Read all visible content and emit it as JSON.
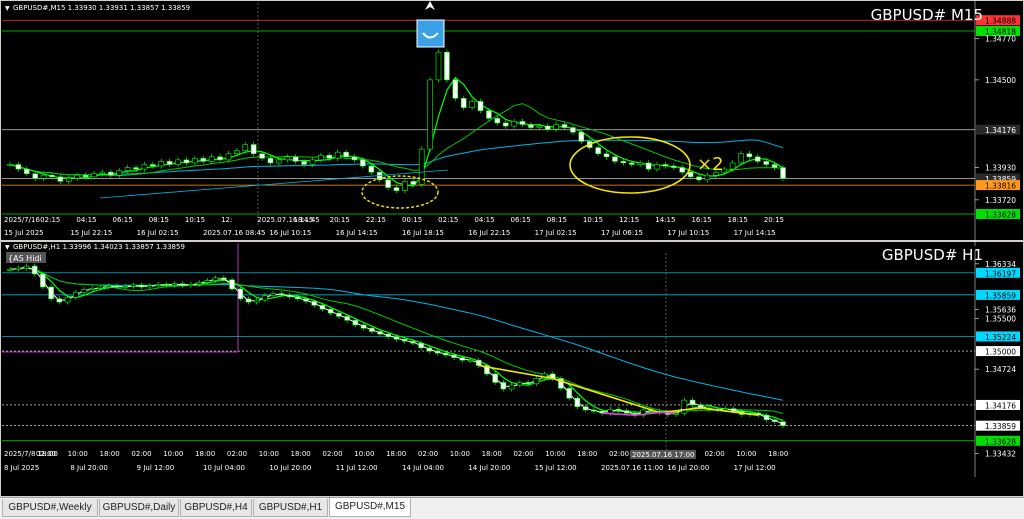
{
  "colors": {
    "background": "#000000",
    "grid_text": "#ffffff",
    "price_line": "#00ff00",
    "ma_fast": "#00c800",
    "ma_slow": "#00b4e6",
    "ma_white": "#ffffff",
    "annotation_yellow": "#f5e600",
    "annotation_magenta": "#e040e0",
    "level_cyan": "#00d8ff",
    "level_green": "#00e000",
    "level_orange": "#ff9a1a",
    "tag_dark": "#2a2a2a"
  },
  "icons": [
    "chevron-down-icon",
    "buy-signal-icon",
    "arrow-down-icon"
  ],
  "chart_data": [
    {
      "type": "line",
      "panel": "top",
      "symbol_header": "GBPUSD#,M15  1.33930 1.33931 1.33857 1.33859",
      "title": "GBPUSD# M15",
      "ylim": [
        1.3355,
        1.35
      ],
      "y_ticks": [
        "1.34888",
        "1.34818",
        "1.34770",
        "1.34500",
        "1.34176",
        "1.33930",
        "1.33859",
        "1.33816",
        "1.33720",
        "1.33628"
      ],
      "highlighted_levels": [
        {
          "label": "1.34888",
          "value": 1.34888,
          "tag_color": "#ff3333"
        },
        {
          "label": "1.34818",
          "value": 1.34818,
          "tag_color": "#00e000"
        },
        {
          "label": "1.34176",
          "value": 1.34176,
          "tag_color": "#2a2a2a"
        },
        {
          "label": "1.33859",
          "value": 1.33859,
          "tag_color": "#2a2a2a"
        },
        {
          "label": "1.33816",
          "value": 1.33816,
          "tag_color": "#ff9a1a"
        },
        {
          "label": "1.33628",
          "value": 1.33628,
          "tag_color": "#00e000"
        }
      ],
      "x_tick_labels_row1": [
        "2025/7/16",
        "02:15",
        "04:15",
        "06:15",
        "08:15",
        "10:15",
        "12:",
        "2025.07.16 14:45",
        "18:15",
        "20:15",
        "22:15",
        "00:15",
        "02:15",
        "04:15",
        "06:15",
        "08:15",
        "10:15",
        "12:15",
        "14:15",
        "16:15",
        "18:15",
        "20:15"
      ],
      "x_tick_labels_row2": [
        "15 Jul 2025",
        "15 Jul 22:15",
        "16 Jul 02:15",
        "2025.07.16 08:45",
        "16 Jul 10:15",
        "16 Jul 14:15",
        "16 Jul 18:15",
        "16 Jul 22:15",
        "17 Jul 02:15",
        "17 Jul 06:15",
        "17 Jul 10:15",
        "17 Jul 14:15"
      ],
      "close": [
        1.3395,
        1.3392,
        1.3389,
        1.3386,
        1.3388,
        1.3387,
        1.3384,
        1.3386,
        1.3388,
        1.3387,
        1.3389,
        1.339,
        1.3388,
        1.3391,
        1.3393,
        1.3392,
        1.3395,
        1.3394,
        1.3397,
        1.3395,
        1.3398,
        1.3396,
        1.3399,
        1.3397,
        1.34,
        1.3398,
        1.3402,
        1.3404,
        1.3408,
        1.3402,
        1.3399,
        1.3396,
        1.3398,
        1.34,
        1.3397,
        1.3395,
        1.3398,
        1.3401,
        1.3399,
        1.3403,
        1.34,
        1.3398,
        1.3394,
        1.339,
        1.3385,
        1.338,
        1.3378,
        1.3384,
        1.3382,
        1.3405,
        1.345,
        1.3468,
        1.345,
        1.3438,
        1.3432,
        1.3436,
        1.343,
        1.3425,
        1.3422,
        1.342,
        1.3423,
        1.3421,
        1.3419,
        1.342,
        1.3418,
        1.3421,
        1.3419,
        1.3416,
        1.341,
        1.3406,
        1.3402,
        1.34,
        1.3397,
        1.3396,
        1.3395,
        1.3396,
        1.3392,
        1.3395,
        1.3394,
        1.3393,
        1.339,
        1.3387,
        1.3385,
        1.3388,
        1.339,
        1.3392,
        1.3396,
        1.3402,
        1.34,
        1.3397,
        1.3395,
        1.3393,
        1.3386
      ]
    },
    {
      "type": "line",
      "panel": "bottom",
      "symbol_header": "GBPUSD#,H1  1.33996 1.34023 1.33857 1.33859",
      "title": "GBPUSD# H1",
      "badge": "{AS Hidi",
      "ylim": [
        1.3338,
        1.365
      ],
      "y_ticks": [
        "1.36334",
        "1.36197",
        "1.35859",
        "1.35636",
        "1.35500",
        "1.35224",
        "1.35000",
        "1.34724",
        "1.34176",
        "1.33859",
        "1.33628",
        "1.33432"
      ],
      "highlighted_levels": [
        {
          "label": "1.36197",
          "value": 1.36197,
          "tag_color": "#00d8ff"
        },
        {
          "label": "1.35859",
          "value": 1.35859,
          "tag_color": "#00d8ff"
        },
        {
          "label": "1.35224",
          "value": 1.35224,
          "tag_color": "#00d8ff"
        },
        {
          "label": "1.35000",
          "value": 1.35,
          "tag_color": "#ffffff"
        },
        {
          "label": "1.34176",
          "value": 1.34176,
          "tag_color": "#ffffff"
        },
        {
          "label": "1.33859",
          "value": 1.33859,
          "tag_color": "#ffffff"
        },
        {
          "label": "1.33628",
          "value": 1.33628,
          "tag_color": "#00e000"
        }
      ],
      "x_tick_labels_row1": [
        "2025/7/8 18:00",
        "02:00",
        "10:00",
        "18:00",
        "02:00",
        "10:00",
        "18:00",
        "02:00",
        "10:00",
        "18:00",
        "02:00",
        "10:00",
        "18:00",
        "02:00",
        "10:00",
        "18:00",
        "02:00",
        "10:00",
        "18:00",
        "02:00",
        "10:00",
        "18:00",
        "02:00",
        "10:00",
        "18:00"
      ],
      "x_tick_labels_row2": [
        "8 Jul 2025",
        "8 Jul 20:00",
        "9 Jul 12:00",
        "10 Jul 04:00",
        "10 Jul 20:00",
        "11 Jul 12:00",
        "14 Jul 04:00",
        "14 Jul 20:00",
        "15 Jul 12:00",
        "2025.07.16 11:00",
        "16 Jul 20:00",
        "17 Jul 12:00"
      ],
      "crosshair_tag": "2025.07.16 17:00",
      "close": [
        1.3625,
        1.3627,
        1.363,
        1.3618,
        1.3598,
        1.358,
        1.3575,
        1.3582,
        1.359,
        1.3594,
        1.3596,
        1.3598,
        1.36,
        1.3598,
        1.3599,
        1.3601,
        1.3598,
        1.36,
        1.3602,
        1.3601,
        1.3603,
        1.36,
        1.3602,
        1.3605,
        1.3608,
        1.3612,
        1.3609,
        1.3595,
        1.358,
        1.3575,
        1.3578,
        1.3585,
        1.3588,
        1.3586,
        1.3583,
        1.358,
        1.3576,
        1.357,
        1.3564,
        1.3558,
        1.3553,
        1.3547,
        1.354,
        1.3535,
        1.353,
        1.3526,
        1.3522,
        1.3518,
        1.3515,
        1.3512,
        1.3505,
        1.35,
        1.3497,
        1.3494,
        1.349,
        1.3486,
        1.3486,
        1.3478,
        1.3465,
        1.3452,
        1.3442,
        1.3448,
        1.3452,
        1.345,
        1.3458,
        1.3465,
        1.3458,
        1.3443,
        1.3428,
        1.3415,
        1.341,
        1.3408,
        1.3405,
        1.3411,
        1.3409,
        1.3405,
        1.3402,
        1.341,
        1.3408,
        1.3406,
        1.3403,
        1.3405,
        1.3425,
        1.3418,
        1.3413,
        1.3411,
        1.341,
        1.3412,
        1.3408,
        1.3403,
        1.3405,
        1.3402,
        1.3395,
        1.3392,
        1.3386
      ],
      "annotations": {
        "yellow_zigzag_idx": [
          57,
          66,
          79,
          84,
          91
        ],
        "magenta_zigzag_idx": [
          72,
          76,
          79,
          81
        ]
      }
    }
  ],
  "tabs": [
    {
      "label": "GBPUSD#,Weekly",
      "active": false
    },
    {
      "label": "GBPUSD#,Daily",
      "active": false
    },
    {
      "label": "GBPUSD#,H4",
      "active": false
    },
    {
      "label": "GBPUSD#,H1",
      "active": false
    },
    {
      "label": "GBPUSD#,M15",
      "active": true
    }
  ]
}
